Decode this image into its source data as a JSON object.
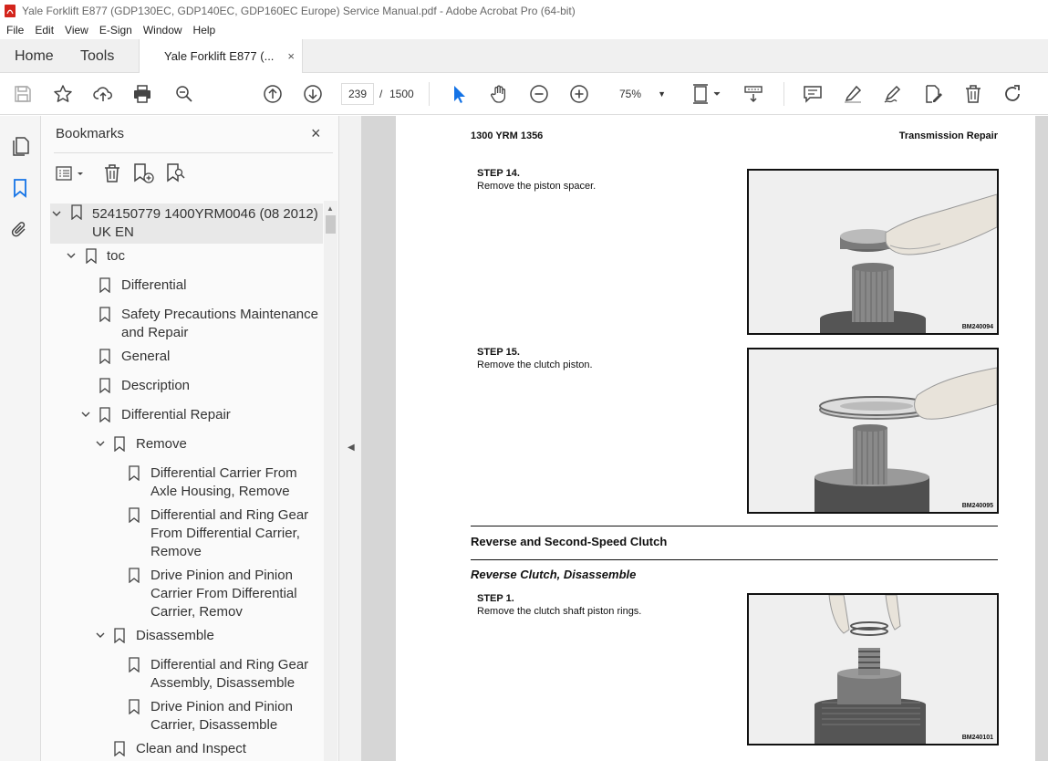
{
  "window": {
    "title": "Yale Forklift E877 (GDP130EC, GDP140EC, GDP160EC Europe) Service Manual.pdf - Adobe Acrobat Pro (64-bit)"
  },
  "menu": [
    "File",
    "Edit",
    "View",
    "E-Sign",
    "Window",
    "Help"
  ],
  "tabs": {
    "home": "Home",
    "tools": "Tools",
    "document": "Yale Forklift E877 (...",
    "close": "×"
  },
  "toolbar": {
    "page_current": "239",
    "page_separator": "/",
    "page_total": "1500",
    "zoom": "75%"
  },
  "bookmarks_panel": {
    "title": "Bookmarks",
    "close": "×",
    "items": [
      {
        "label": "524150779 1400YRM0046 (08 2012) UK EN",
        "expanded": true
      },
      {
        "label": "toc",
        "expanded": true
      },
      {
        "label": "Differential"
      },
      {
        "label": "Safety Precautions Maintenance and Repair"
      },
      {
        "label": "General"
      },
      {
        "label": "Description"
      },
      {
        "label": "Differential Repair",
        "expanded": true
      },
      {
        "label": "Remove",
        "expanded": true
      },
      {
        "label": "Differential Carrier From Axle Housing, Remove"
      },
      {
        "label": "Differential and Ring Gear From Differential Carrier, Remove"
      },
      {
        "label": "Drive Pinion and Pinion Carrier From Differential Carrier, Remov"
      },
      {
        "label": "Disassemble",
        "expanded": true
      },
      {
        "label": "Differential and Ring Gear Assembly, Disassemble"
      },
      {
        "label": "Drive Pinion and Pinion Carrier, Disassemble"
      },
      {
        "label": "Clean and Inspect"
      }
    ],
    "lines": {
      "i0": [
        "524150779 1400YRM0046 (08 2012)",
        "UK EN"
      ],
      "i3": [
        "Safety Precautions Maintenance",
        "and Repair"
      ],
      "i8": [
        "Differential Carrier From",
        "Axle Housing, Remove"
      ],
      "i9": [
        "Differential and Ring Gear",
        "From Differential Carrier,",
        "Remove"
      ],
      "i10": [
        "Drive Pinion and Pinion",
        "Carrier From Differential",
        "Carrier, Remov"
      ],
      "i12": [
        "Differential and Ring Gear",
        "Assembly, Disassemble"
      ],
      "i13": [
        "Drive Pinion and Pinion",
        "Carrier, Disassemble"
      ]
    }
  },
  "page": {
    "doc_number": "1300 YRM 1356",
    "section": "Transmission Repair",
    "steps": [
      {
        "title": "STEP 14.",
        "text": "Remove the piston spacer.",
        "photo_code": "BM240094"
      },
      {
        "title": "STEP 15.",
        "text": "Remove the clutch piston.",
        "photo_code": "BM240095"
      },
      {
        "title": "STEP 1.",
        "text": "Remove the clutch shaft piston rings.",
        "photo_code": "BM240101"
      }
    ],
    "section_heading": "Reverse and Second-Speed Clutch",
    "sub_heading": "Reverse Clutch, Disassemble"
  }
}
